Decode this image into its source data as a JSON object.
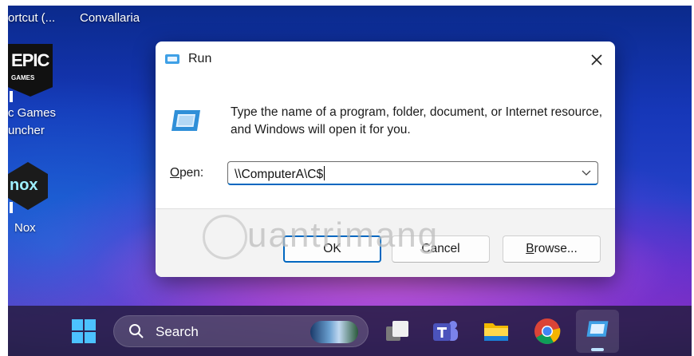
{
  "desktop": {
    "top_labels": [
      "ortcut (...",
      "Convallaria"
    ],
    "epic": {
      "logo_top": "EPIC",
      "logo_bottom": "GAMES",
      "label_line1": "c Games",
      "label_line2": "uncher"
    },
    "nox": {
      "logo": "nox",
      "label": "Nox"
    }
  },
  "dialog": {
    "title": "Run",
    "description": "Type the name of a program, folder, document, or Internet resource, and Windows will open it for you.",
    "open_label_mnemonic": "O",
    "open_label_rest": "pen:",
    "open_value": "\\\\ComputerA\\C$",
    "ok_label": "OK",
    "cancel_label": "Cancel",
    "browse_mnemonic": "B",
    "browse_rest": "rowse..."
  },
  "watermark": "uantrimang",
  "taskbar": {
    "search_label": "Search"
  },
  "colors": {
    "accent": "#0067c0",
    "taskbar": "#281e46",
    "start_icon": "#4cc2ff"
  }
}
